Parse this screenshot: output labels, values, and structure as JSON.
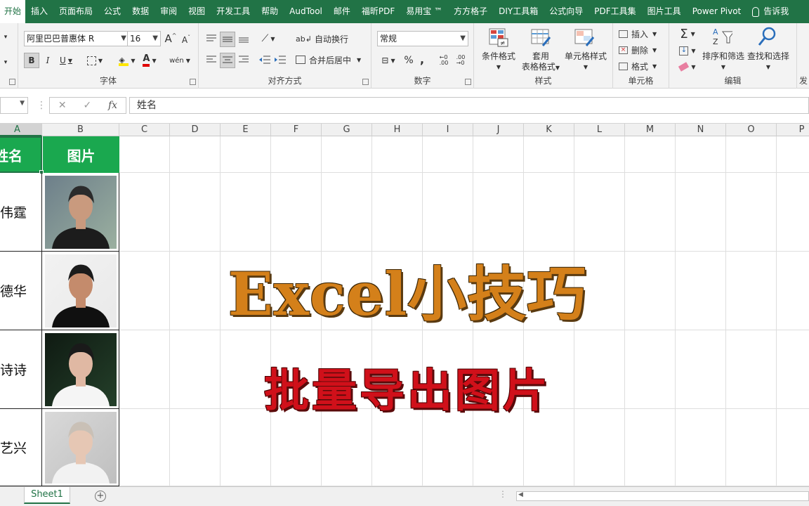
{
  "tabs": [
    "开始",
    "插入",
    "页面布局",
    "公式",
    "数据",
    "审阅",
    "视图",
    "开发工具",
    "帮助",
    "AudTool",
    "邮件",
    "福昕PDF",
    "易用宝 ™",
    "方方格子",
    "DIY工具箱",
    "公式向导",
    "PDF工具集",
    "图片工具",
    "Power Pivot",
    "告诉我"
  ],
  "ribbon": {
    "font": {
      "label": "字体",
      "font_name": "阿里巴巴普惠体 R",
      "font_size": "16",
      "bold": "B",
      "italic": "I",
      "underline": "U",
      "grow": "A",
      "shrink": "A",
      "phonetic": "wén"
    },
    "align": {
      "label": "对齐方式",
      "wrap_text": "自动换行",
      "merge_center": "合并后居中"
    },
    "number": {
      "label": "数字",
      "format": "常规",
      "percent": "%",
      "comma": ","
    },
    "styles": {
      "label": "样式",
      "conditional": "条件格式",
      "table_format_1": "套用",
      "table_format_2": "表格格式",
      "cell_styles": "单元格样式"
    },
    "cells": {
      "label": "单元格",
      "insert": "插入",
      "delete": "删除",
      "format": "格式"
    },
    "editing": {
      "label": "编辑",
      "sort_filter": "排序和筛选",
      "find_select": "查找和选择"
    },
    "cut_label": "发"
  },
  "formula_bar": {
    "fx": "fx",
    "content": "姓名"
  },
  "columns": [
    "A",
    "B",
    "C",
    "D",
    "E",
    "F",
    "G",
    "H",
    "I",
    "J",
    "K",
    "L",
    "M",
    "N",
    "O",
    "P"
  ],
  "table": {
    "header_name": "姓名",
    "header_photo": "图片",
    "rows": [
      {
        "name": "伟霆"
      },
      {
        "name": "德华"
      },
      {
        "name": "诗诗"
      },
      {
        "name": "艺兴"
      }
    ]
  },
  "overlay": {
    "title": "Excel小技巧",
    "subtitle": "批量导出图片"
  },
  "sheet": {
    "tab_name": "Sheet1",
    "add": "+"
  },
  "colors": {
    "excel_green": "#217346",
    "header_green": "#1aa84f",
    "title_orange": "#d4801a",
    "subtitle_red": "#d0101a"
  }
}
